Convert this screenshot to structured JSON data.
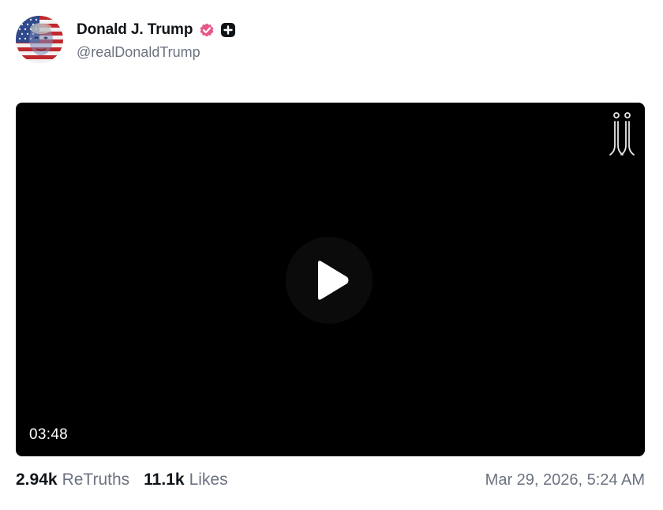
{
  "author": {
    "display_name": "Donald J. Trump",
    "handle": "@realDonaldTrump",
    "avatar_icon": "flag-portrait-avatar",
    "verified_icon": "verified-check-icon",
    "verified_color": "#e5588a",
    "plus_icon": "plus-badge-icon"
  },
  "video": {
    "duration": "03:48",
    "play_icon": "play-icon",
    "logo_icon": "truth-social-watermark-icon",
    "background_color": "#000000"
  },
  "stats": {
    "retruths_count": "2.94k",
    "retruths_label": "ReTruths",
    "likes_count": "11.1k",
    "likes_label": "Likes"
  },
  "timestamp": "Mar 29, 2026, 5:24 AM"
}
